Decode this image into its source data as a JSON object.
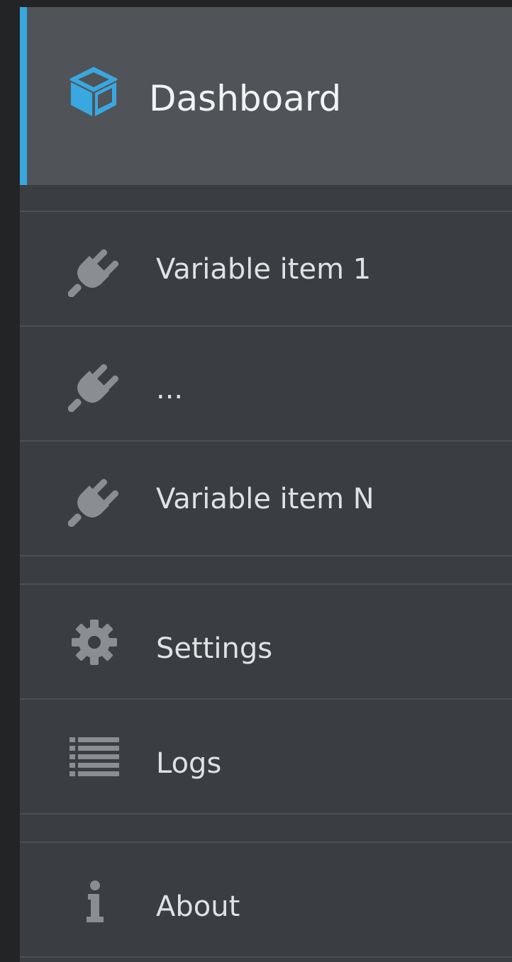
{
  "colors": {
    "accent": "#3aa8e0",
    "icon_gray": "#8a8d91"
  },
  "nav": {
    "dashboard": {
      "label": "Dashboard",
      "icon": "cube-icon"
    },
    "items": [
      {
        "label": "Variable item 1",
        "icon": "plug-icon"
      },
      {
        "label": "...",
        "icon": "plug-icon"
      },
      {
        "label": "Variable item N",
        "icon": "plug-icon"
      }
    ],
    "settings": {
      "label": "Settings",
      "icon": "gear-icon"
    },
    "logs": {
      "label": "Logs",
      "icon": "list-icon"
    },
    "about": {
      "label": "About",
      "icon": "info-icon"
    }
  }
}
